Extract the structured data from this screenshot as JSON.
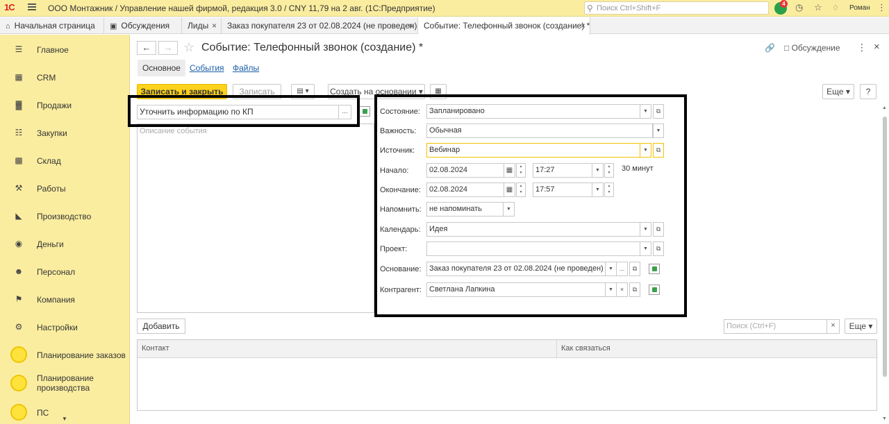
{
  "topbar": {
    "logo": "1С",
    "title": "ООО Монтажник / Управление нашей фирмой, редакция 3.0 / CNY 11,79 на 2 авг.  (1С:Предприятие)",
    "search_placeholder": "Поиск Ctrl+Shift+F",
    "notification_count": "4",
    "user": "Роман"
  },
  "tabs": [
    {
      "label": "Начальная страница",
      "icon": "home-icon"
    },
    {
      "label": "Обсуждения",
      "icon": "chat-icon"
    },
    {
      "label": "Лиды"
    },
    {
      "label": "Заказ покупателя 23 от 02.08.2024 (не проведен)"
    },
    {
      "label": "Событие: Телефонный звонок (создание) *"
    }
  ],
  "sidebar": [
    {
      "label": "Главное",
      "icon": "list-icon"
    },
    {
      "label": "CRM",
      "icon": "crm-icon"
    },
    {
      "label": "Продажи",
      "icon": "basket-icon"
    },
    {
      "label": "Закупки",
      "icon": "cart-icon"
    },
    {
      "label": "Склад",
      "icon": "warehouse-icon"
    },
    {
      "label": "Работы",
      "icon": "tools-icon"
    },
    {
      "label": "Производство",
      "icon": "factory-icon"
    },
    {
      "label": "Деньги",
      "icon": "money-icon"
    },
    {
      "label": "Персонал",
      "icon": "people-icon"
    },
    {
      "label": "Компания",
      "icon": "flag-icon"
    },
    {
      "label": "Настройки",
      "icon": "gear-icon"
    },
    {
      "label": "Планирование заказов",
      "icon": "circle-icon"
    },
    {
      "label_line1": "Планирование",
      "label_line2": "производства",
      "icon": "circle-icon"
    },
    {
      "label": "ПС",
      "icon": "circle-icon"
    }
  ],
  "header": {
    "title": "Событие: Телефонный звонок (создание) *",
    "discussion": "Обсуждение"
  },
  "subtabs": [
    "Основное",
    "События",
    "Файлы"
  ],
  "toolbar": {
    "save_close": "Записать и закрыть",
    "save": "Записать",
    "create_based": "Создать на основании",
    "more": "Еще",
    "help": "?"
  },
  "left": {
    "subject_value": "Уточнить информацию по КП",
    "description_placeholder": "Описание события"
  },
  "form": {
    "state_label": "Состояние:",
    "state_value": "Запланировано",
    "importance_label": "Важность:",
    "importance_value": "Обычная",
    "source_label": "Источник:",
    "source_value": "Вебинар",
    "start_label": "Начало:",
    "start_date": "02.08.2024",
    "start_time": "17:27",
    "duration": "30 минут",
    "end_label": "Окончание:",
    "end_date": "02.08.2024",
    "end_time": "17:57",
    "remind_label": "Напомнить:",
    "remind_value": "не напоминать",
    "calendar_label": "Календарь:",
    "calendar_value": "Идея",
    "project_label": "Проект:",
    "project_value": "",
    "basis_label": "Основание:",
    "basis_value": "Заказ покупателя 23 от 02.08.2024 (не проведен)",
    "counterparty_label": "Контрагент:",
    "counterparty_value": "Светлана Лапкина"
  },
  "contacts": {
    "add": "Добавить",
    "search_placeholder": "Поиск (Ctrl+F)",
    "more": "Еще",
    "col_contact": "Контакт",
    "col_how": "Как связаться"
  }
}
